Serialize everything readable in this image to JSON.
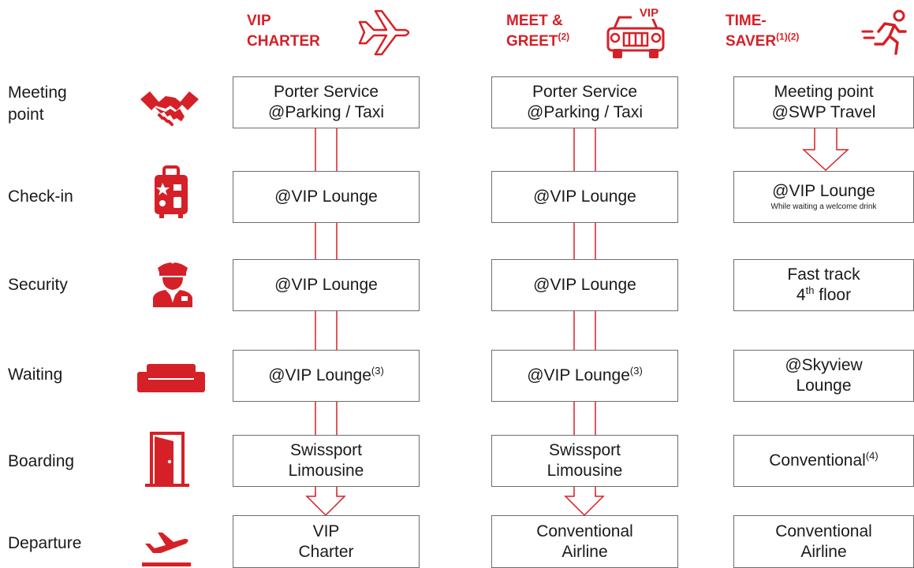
{
  "columns": [
    {
      "title": [
        "VIP",
        "CHARTER"
      ],
      "title_sup": "",
      "icon": "airplane-icon",
      "steps": [
        {
          "lines": [
            "Porter Service",
            "@Parking / Taxi"
          ]
        },
        {
          "lines": [
            "@VIP Lounge"
          ]
        },
        {
          "lines": [
            "@VIP Lounge"
          ]
        },
        {
          "lines": [
            "@VIP Lounge"
          ],
          "sup": "(3)"
        },
        {
          "lines": [
            "Swissport",
            "Limousine"
          ]
        },
        {
          "lines": [
            "VIP",
            "Charter"
          ]
        }
      ]
    },
    {
      "title": [
        "MEET &",
        "GREET"
      ],
      "title_sup": "(2)",
      "icon": "vip-car-icon",
      "icon_text": "VIP",
      "steps": [
        {
          "lines": [
            "Porter Service",
            "@Parking / Taxi"
          ]
        },
        {
          "lines": [
            "@VIP Lounge"
          ]
        },
        {
          "lines": [
            "@VIP Lounge"
          ]
        },
        {
          "lines": [
            "@VIP Lounge"
          ],
          "sup": "(3)"
        },
        {
          "lines": [
            "Swissport",
            "Limousine"
          ]
        },
        {
          "lines": [
            "Conventional",
            "Airline"
          ]
        }
      ]
    },
    {
      "title": [
        "TIME-",
        "SAVER"
      ],
      "title_sup": "(1)(2)",
      "icon": "running-person-icon",
      "steps": [
        {
          "lines": [
            "Meeting point",
            "@SWP Travel"
          ]
        },
        {
          "lines": [
            "@VIP Lounge"
          ],
          "note": "While waiting a welcome drink"
        },
        {
          "lines": [
            "Fast track",
            "4"
          ],
          "sup2": "th",
          "after_sup2": " floor"
        },
        {
          "lines": [
            "@Skyview",
            "Lounge"
          ]
        },
        {
          "lines": [
            "Conventional"
          ],
          "sup": "(4)"
        },
        {
          "lines": [
            "Conventional",
            "Airline"
          ]
        }
      ]
    }
  ],
  "rows": [
    {
      "label": [
        "Meeting",
        "point"
      ],
      "icon": "handshake-icon"
    },
    {
      "label": [
        "Check-in"
      ],
      "icon": "luggage-icon"
    },
    {
      "label": [
        "Security"
      ],
      "icon": "security-officer-icon"
    },
    {
      "label": [
        "Waiting"
      ],
      "icon": "sofa-icon"
    },
    {
      "label": [
        "Boarding"
      ],
      "icon": "door-icon"
    },
    {
      "label": [
        "Departure"
      ],
      "icon": "departure-plane-icon"
    }
  ],
  "colors": {
    "accent": "#d62027",
    "border": "#6d6d6d",
    "text": "#1a1a1a"
  }
}
